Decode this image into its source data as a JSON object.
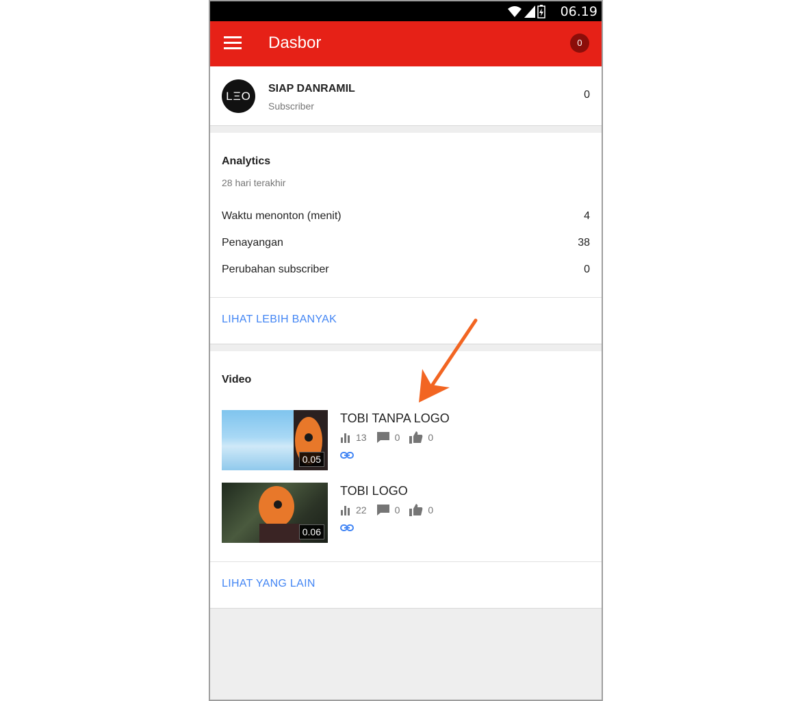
{
  "status_bar": {
    "time": "06.19"
  },
  "app_bar": {
    "title": "Dasbor",
    "notification_count": "0"
  },
  "channel": {
    "avatar_text": "LΞO",
    "name": "SIAP DANRAMIL",
    "subtitle": "Subscriber",
    "count": "0"
  },
  "analytics": {
    "title": "Analytics",
    "subtitle": "28 hari terakhir",
    "metrics": [
      {
        "label": "Waktu menonton (menit)",
        "value": "4"
      },
      {
        "label": "Penayangan",
        "value": "38"
      },
      {
        "label": "Perubahan subscriber",
        "value": "0"
      }
    ],
    "more_label": "LIHAT LEBIH BANYAK"
  },
  "videos": {
    "title": "Video",
    "items": [
      {
        "title": "TOBI TANPA LOGO",
        "duration": "0.05",
        "views": "13",
        "comments": "0",
        "likes": "0"
      },
      {
        "title": "TOBI LOGO",
        "duration": "0.06",
        "views": "22",
        "comments": "0",
        "likes": "0"
      }
    ],
    "more_label": "LIHAT YANG LAIN"
  },
  "colors": {
    "app_bar": "#e62117",
    "link": "#4285f4",
    "annotation_arrow": "#f26522"
  }
}
